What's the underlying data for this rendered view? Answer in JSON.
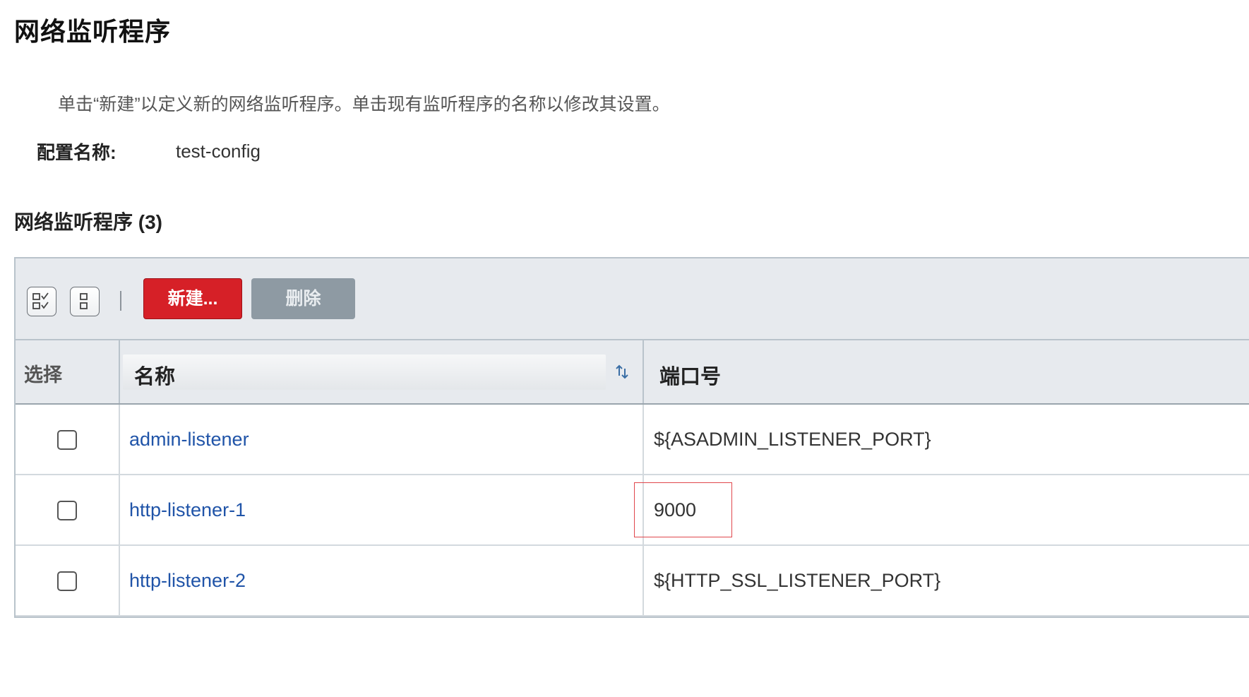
{
  "page": {
    "title": "网络监听程序",
    "help_text": "单击“新建”以定义新的网络监听程序。单击现有监听程序的名称以修改其设置。",
    "config_label": "配置名称:",
    "config_value": "test-config",
    "section_title": "网络监听程序 (3)"
  },
  "toolbar": {
    "select_all_icon": "select-all-icon",
    "deselect_all_icon": "deselect-all-icon",
    "new_label": "新建...",
    "delete_label": "删除",
    "new_color": "#d62027",
    "delete_color": "#8e9aa3"
  },
  "table": {
    "headers": {
      "select": "选择",
      "name": "名称",
      "port": "端口号"
    },
    "rows": [
      {
        "name": "admin-listener",
        "port": "${ASADMIN_LISTENER_PORT}"
      },
      {
        "name": "http-listener-1",
        "port": "9000"
      },
      {
        "name": "http-listener-2",
        "port": "${HTTP_SSL_LISTENER_PORT}"
      }
    ],
    "highlighted_row": 1,
    "link_color": "#2054a8",
    "highlight_color": "#e0474c"
  }
}
